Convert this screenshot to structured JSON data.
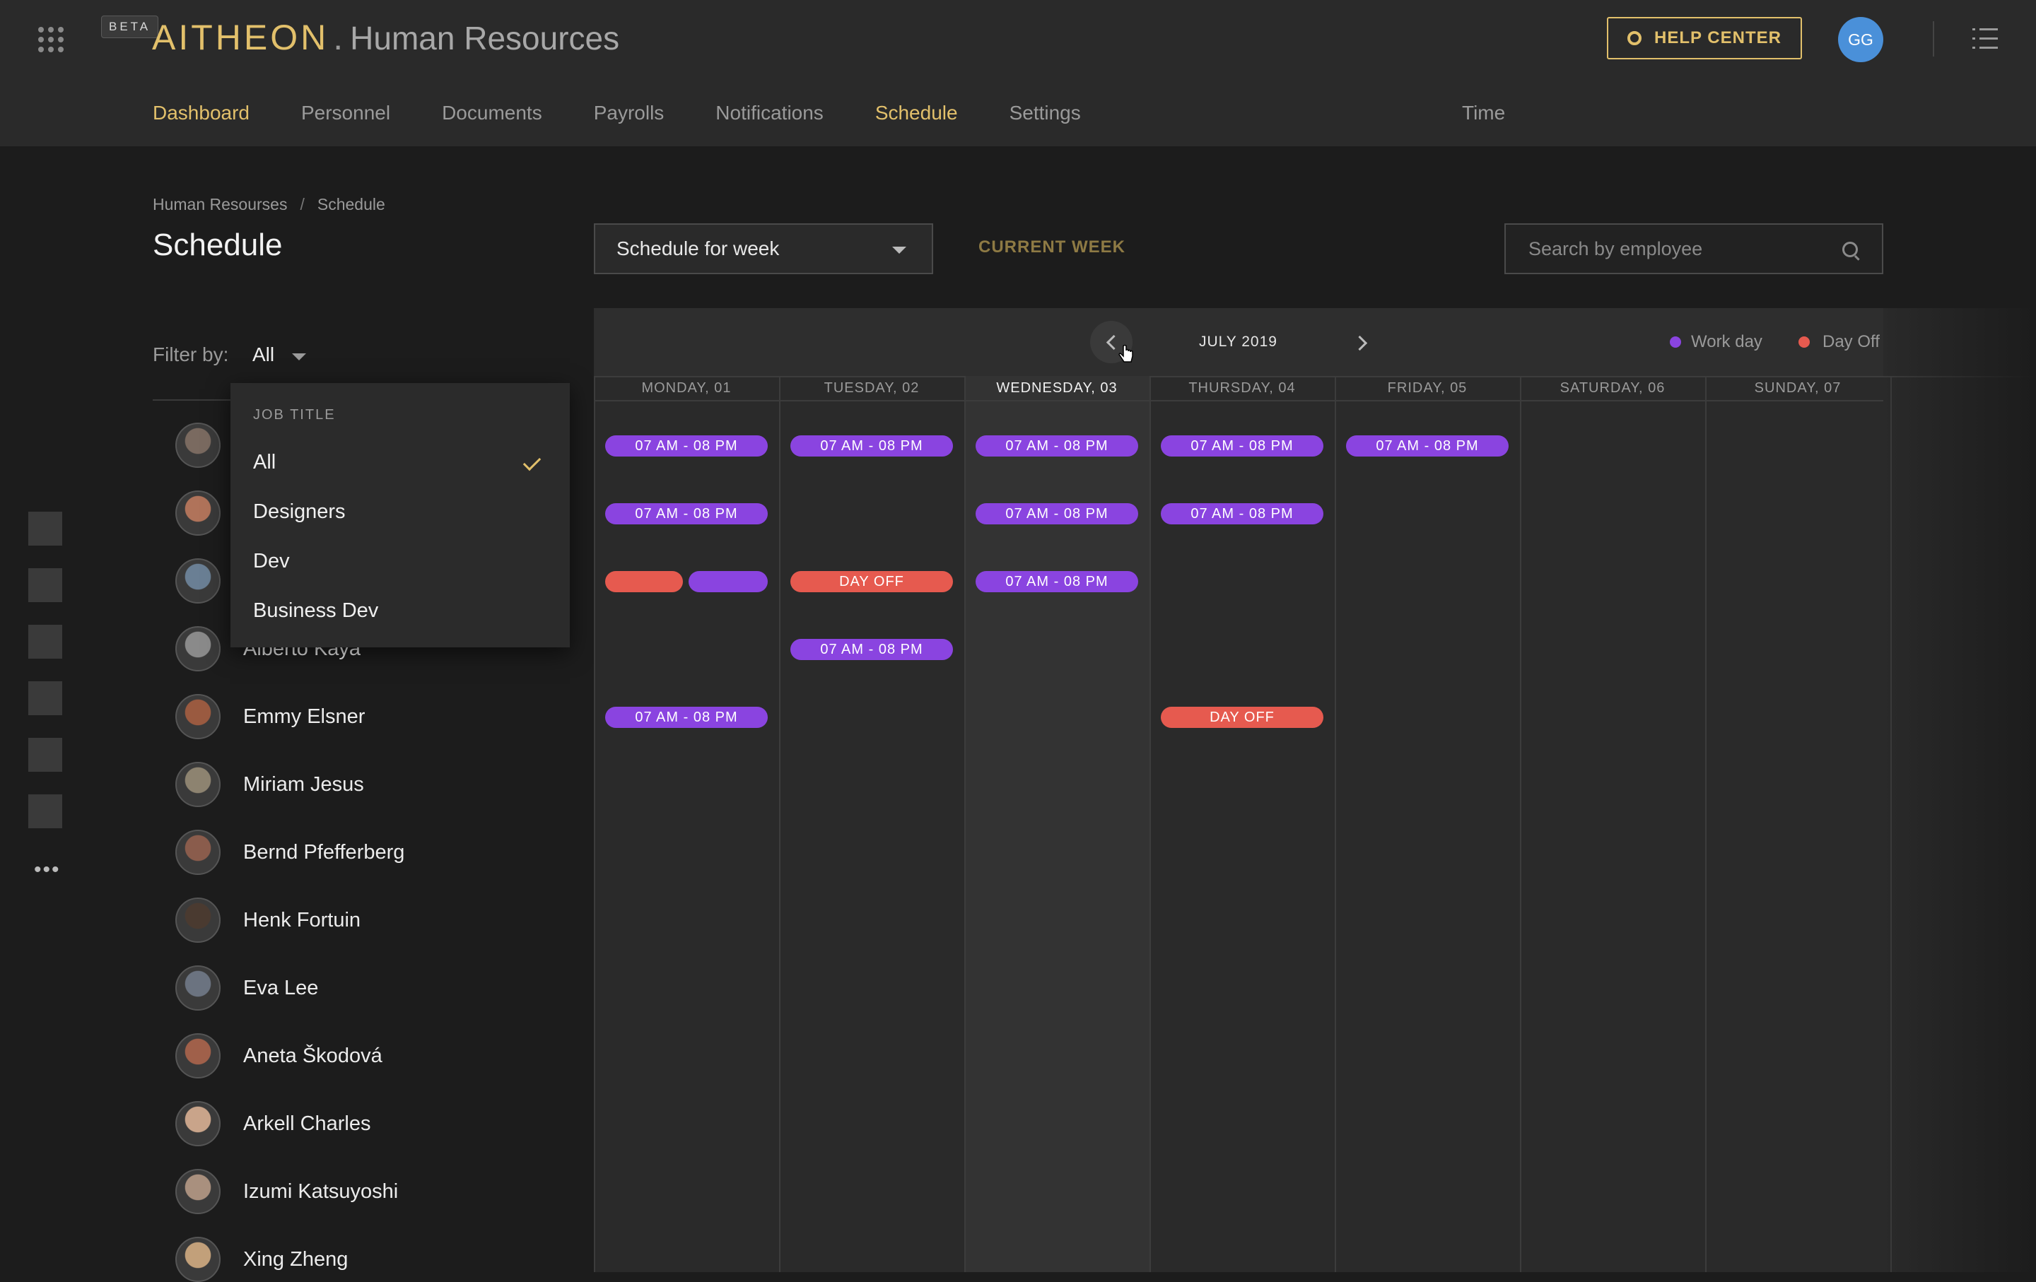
{
  "header": {
    "beta": "BETA",
    "logo": "AITHEON",
    "dot": ".",
    "app_name": "Human Resources",
    "help_label": "HELP CENTER",
    "user_initials": "GG",
    "nav": [
      {
        "label": "Dashboard",
        "active": true
      },
      {
        "label": "Personnel",
        "active": false
      },
      {
        "label": "Documents",
        "active": false
      },
      {
        "label": "Payrolls",
        "active": false
      },
      {
        "label": "Notifications",
        "active": false
      },
      {
        "label": "Schedule",
        "active": true
      },
      {
        "label": "Settings",
        "active": false
      }
    ],
    "nav_time": "Time"
  },
  "breadcrumb": [
    "Human Resourses",
    "/",
    "Schedule"
  ],
  "page": {
    "title": "Schedule",
    "week_select": "Schedule for week",
    "current_week": "CURRENT WEEK",
    "search_placeholder": "Search by employee"
  },
  "filter": {
    "label": "Filter by:",
    "value": "All",
    "dropdown_header": "JOB TITLE",
    "options": [
      "All",
      "Designers",
      "Dev",
      "Business Dev"
    ],
    "selected": "All"
  },
  "employees": [
    "",
    "",
    "",
    "Alberto Kaya",
    "Emmy Elsner",
    "Miriam Jesus",
    "Bernd Pfefferberg",
    "Henk Fortuin",
    "Eva Lee",
    "Aneta Škodová",
    "Arkell Charles",
    "Izumi Katsuyoshi",
    "Xing Zheng"
  ],
  "calendar": {
    "month": "JULY 2019",
    "legend": {
      "work": "Work day",
      "off": "Day Off"
    },
    "colors": {
      "work": "#8a44e0",
      "off": "#e65a4f",
      "accent": "#e2c06b"
    },
    "days": [
      "MONDAY, 01",
      "TUESDAY, 02",
      "WEDNESDAY, 03",
      "THURSDAY, 04",
      "FRIDAY, 05",
      "SATURDAY, 06",
      "SUNDAY, 07"
    ],
    "today_index": 2,
    "shift_text": "07 AM - 08 PM",
    "dayoff_text": "DAY OFF",
    "rows": [
      [
        "work",
        "work",
        "work",
        "work",
        "work",
        "",
        ""
      ],
      [
        "work",
        "",
        "work",
        "work",
        "",
        "",
        ""
      ],
      [
        "off+work",
        "off",
        "work",
        "",
        "",
        "",
        ""
      ],
      [
        "",
        "work",
        "",
        "",
        "",
        "",
        ""
      ],
      [
        "work",
        "",
        "",
        "off",
        "",
        "",
        ""
      ]
    ]
  }
}
